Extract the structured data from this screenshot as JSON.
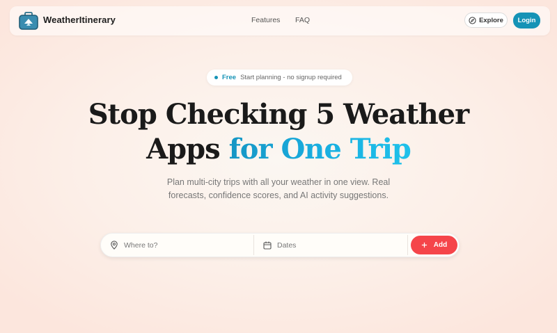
{
  "header": {
    "brand": "WeatherItinerary",
    "nav": {
      "features": "Features",
      "faq": "FAQ"
    },
    "explore_label": "Explore",
    "login_label": "Login"
  },
  "hero": {
    "badge": {
      "free": "Free",
      "text": "Start planning - no signup required"
    },
    "headline_line1": "Stop Checking 5 Weather",
    "headline_line2_plain": "Apps",
    "headline_line2_accent": "for One Trip",
    "subhead_line1": "Plan multi-city trips with all your weather in one view. Real",
    "subhead_line2": "forecasts, confidence scores, and AI activity suggestions."
  },
  "search": {
    "where_placeholder": "Where to?",
    "dates_placeholder": "Dates",
    "add_label": "Add"
  },
  "colors": {
    "accent": "#1593b6",
    "cta": "#f5454a"
  },
  "icons": [
    "suitcase-logo-icon",
    "compass-icon",
    "map-pin-icon",
    "calendar-icon",
    "plus-icon"
  ]
}
